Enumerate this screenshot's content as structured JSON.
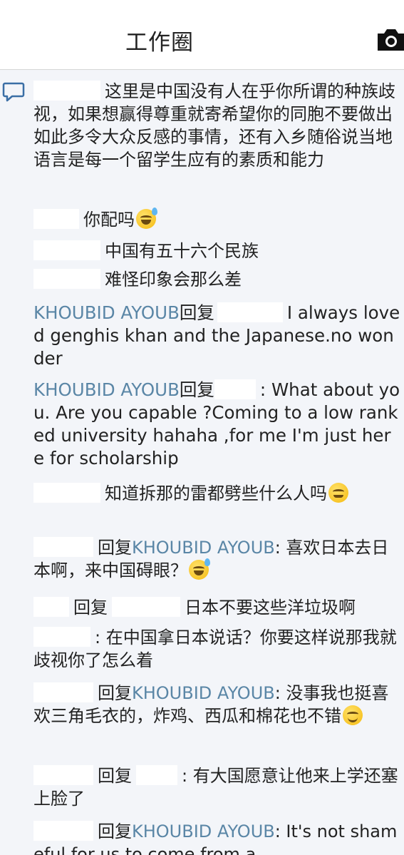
{
  "header": {
    "title": "工作圈",
    "camera_icon": "camera-icon"
  },
  "comment_icon": "comment-bubble-icon",
  "colors": {
    "name_link": "#5a86a6",
    "feed_bg": "#f3f5f9",
    "text": "#222222"
  },
  "comments": [
    {
      "text": "这里是中国没有人在乎你所谓的种族歧视，如果想赢得尊重就寄希望你的同胞不要做出如此多令大众反感的事情，还有入乡随俗说当地语言是每一个留学生应有的素质和能力"
    },
    {
      "text": "你配吗",
      "emoji": "grinning-sweat"
    },
    {
      "text": "中国有五十六个民族"
    },
    {
      "text": "难怪印象会那么差"
    },
    {
      "name": "KHOUBID AYOUB",
      "reply_word": "回复",
      "text": "I always loved genghis khan and the Japanese.no wonder"
    },
    {
      "name": "KHOUBID AYOUB",
      "reply_word": "回复",
      "text": ": What about you. Are you capable ?Coming to a low ranked university hahaha ,for me I'm just here for scholarship"
    },
    {
      "text": "知道拆那的雷都劈些什么人吗",
      "emoji": "winking-face"
    },
    {
      "reply_word": "回复",
      "name": "KHOUBID AYOUB",
      "text": ": 喜欢日本去日本啊，来中国碍眼？",
      "emoji": "grinning-sweat"
    },
    {
      "reply_word": "回复",
      "text": "日本不要这些洋垃圾啊"
    },
    {
      "text": ": 在中国拿日本说话？你要这样说那我就歧视你了怎么着"
    },
    {
      "reply_word": "回复",
      "name": "KHOUBID AYOUB",
      "text": ": 没事我也挺喜欢三角毛衣的，炸鸡、西瓜和棉花也不错",
      "emoji": "smiling-face"
    },
    {
      "reply_word": "回复",
      "text": ": 有大国愿意让他来上学还塞上脸了"
    },
    {
      "reply_word": "回复",
      "name": "KHOUBID AYOUB",
      "text": ": It's not shameful for us to come from a"
    }
  ]
}
